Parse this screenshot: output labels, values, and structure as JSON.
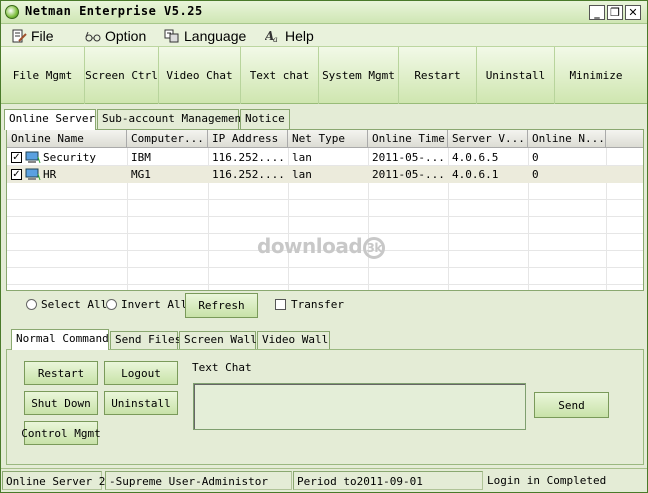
{
  "window": {
    "title": "Netman Enterprise V5.25",
    "minimize_glyph": "_",
    "maximize_glyph": "❐",
    "close_glyph": "✕"
  },
  "menu": [
    {
      "label": "File",
      "icon": "file-edit-icon"
    },
    {
      "label": "Option",
      "icon": "glasses-icon"
    },
    {
      "label": "Language",
      "icon": "language-icon"
    },
    {
      "label": "Help",
      "icon": "help-icon"
    }
  ],
  "toolbar": [
    "File Mgmt",
    "Screen Ctrl",
    "Video Chat",
    "Text chat",
    "System Mgmt",
    "Restart",
    "Uninstall",
    "Minimize"
  ],
  "main_tabs": [
    "Online Server",
    "Sub-account Management",
    "Notice"
  ],
  "table": {
    "columns": [
      "Online Name",
      "Computer...",
      "IP Address",
      "Net Type",
      "Online Time",
      "Server V...",
      "Online N..."
    ],
    "rows": [
      {
        "checked": true,
        "cells": [
          "Security",
          "IBM",
          "116.252....",
          "lan",
          "2011-05-...",
          "4.0.6.5",
          "0"
        ]
      },
      {
        "checked": true,
        "cells": [
          "HR",
          "MG1",
          "116.252....",
          "lan",
          "2011-05-...",
          "4.0.6.1",
          "0"
        ]
      }
    ]
  },
  "watermark": {
    "text": "download",
    "mark": "3k"
  },
  "controls": {
    "select_all": "Select All",
    "invert_all": "Invert All",
    "refresh": "Refresh",
    "transfer": "Transfer"
  },
  "cmd_tabs": [
    "Normal Command",
    "Send Files",
    "Screen Wall",
    "Video Wall"
  ],
  "commands": {
    "restart": "Restart",
    "logout": "Logout",
    "shut_down": "Shut Down",
    "uninstall": "Uninstall",
    "control_mgmt": "Control Mgmt",
    "text_chat_label": "Text Chat",
    "send": "Send"
  },
  "statusbar": {
    "online_server": "Online Server 2",
    "user": "-Supreme User-Administor",
    "period": "Period to2011-09-01",
    "login": "Login in Completed"
  },
  "colors": {
    "accent_green": "#c8e2a8",
    "frame": "#e4ecd6",
    "selected_row": "#ecebdc"
  }
}
